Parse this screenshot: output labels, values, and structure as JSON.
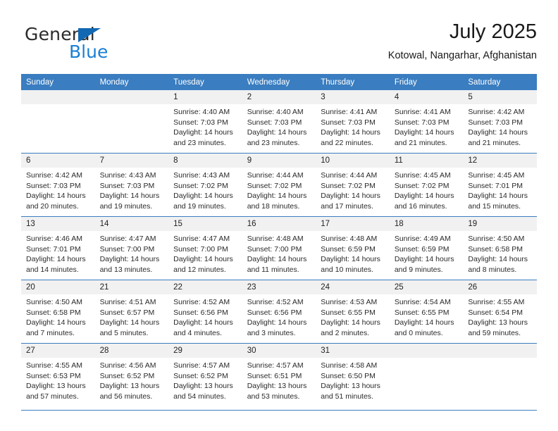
{
  "brand": {
    "word_one": "General",
    "word_two": "Blue",
    "triangle_icon": "brand-triangle-icon"
  },
  "header": {
    "title": "July 2025",
    "location": "Kotowal, Nangarhar, Afghanistan"
  },
  "calendar": {
    "weekday_headers": [
      "Sunday",
      "Monday",
      "Tuesday",
      "Wednesday",
      "Thursday",
      "Friday",
      "Saturday"
    ],
    "header_bg": "#3a7dc0",
    "daynum_bg": "#f1f1f1",
    "weeks": [
      [
        {
          "day": "",
          "lines": []
        },
        {
          "day": "",
          "lines": []
        },
        {
          "day": "1",
          "lines": [
            "Sunrise: 4:40 AM",
            "Sunset: 7:03 PM",
            "Daylight: 14 hours",
            "and 23 minutes."
          ]
        },
        {
          "day": "2",
          "lines": [
            "Sunrise: 4:40 AM",
            "Sunset: 7:03 PM",
            "Daylight: 14 hours",
            "and 23 minutes."
          ]
        },
        {
          "day": "3",
          "lines": [
            "Sunrise: 4:41 AM",
            "Sunset: 7:03 PM",
            "Daylight: 14 hours",
            "and 22 minutes."
          ]
        },
        {
          "day": "4",
          "lines": [
            "Sunrise: 4:41 AM",
            "Sunset: 7:03 PM",
            "Daylight: 14 hours",
            "and 21 minutes."
          ]
        },
        {
          "day": "5",
          "lines": [
            "Sunrise: 4:42 AM",
            "Sunset: 7:03 PM",
            "Daylight: 14 hours",
            "and 21 minutes."
          ]
        }
      ],
      [
        {
          "day": "6",
          "lines": [
            "Sunrise: 4:42 AM",
            "Sunset: 7:03 PM",
            "Daylight: 14 hours",
            "and 20 minutes."
          ]
        },
        {
          "day": "7",
          "lines": [
            "Sunrise: 4:43 AM",
            "Sunset: 7:03 PM",
            "Daylight: 14 hours",
            "and 19 minutes."
          ]
        },
        {
          "day": "8",
          "lines": [
            "Sunrise: 4:43 AM",
            "Sunset: 7:02 PM",
            "Daylight: 14 hours",
            "and 19 minutes."
          ]
        },
        {
          "day": "9",
          "lines": [
            "Sunrise: 4:44 AM",
            "Sunset: 7:02 PM",
            "Daylight: 14 hours",
            "and 18 minutes."
          ]
        },
        {
          "day": "10",
          "lines": [
            "Sunrise: 4:44 AM",
            "Sunset: 7:02 PM",
            "Daylight: 14 hours",
            "and 17 minutes."
          ]
        },
        {
          "day": "11",
          "lines": [
            "Sunrise: 4:45 AM",
            "Sunset: 7:02 PM",
            "Daylight: 14 hours",
            "and 16 minutes."
          ]
        },
        {
          "day": "12",
          "lines": [
            "Sunrise: 4:45 AM",
            "Sunset: 7:01 PM",
            "Daylight: 14 hours",
            "and 15 minutes."
          ]
        }
      ],
      [
        {
          "day": "13",
          "lines": [
            "Sunrise: 4:46 AM",
            "Sunset: 7:01 PM",
            "Daylight: 14 hours",
            "and 14 minutes."
          ]
        },
        {
          "day": "14",
          "lines": [
            "Sunrise: 4:47 AM",
            "Sunset: 7:00 PM",
            "Daylight: 14 hours",
            "and 13 minutes."
          ]
        },
        {
          "day": "15",
          "lines": [
            "Sunrise: 4:47 AM",
            "Sunset: 7:00 PM",
            "Daylight: 14 hours",
            "and 12 minutes."
          ]
        },
        {
          "day": "16",
          "lines": [
            "Sunrise: 4:48 AM",
            "Sunset: 7:00 PM",
            "Daylight: 14 hours",
            "and 11 minutes."
          ]
        },
        {
          "day": "17",
          "lines": [
            "Sunrise: 4:48 AM",
            "Sunset: 6:59 PM",
            "Daylight: 14 hours",
            "and 10 minutes."
          ]
        },
        {
          "day": "18",
          "lines": [
            "Sunrise: 4:49 AM",
            "Sunset: 6:59 PM",
            "Daylight: 14 hours",
            "and 9 minutes."
          ]
        },
        {
          "day": "19",
          "lines": [
            "Sunrise: 4:50 AM",
            "Sunset: 6:58 PM",
            "Daylight: 14 hours",
            "and 8 minutes."
          ]
        }
      ],
      [
        {
          "day": "20",
          "lines": [
            "Sunrise: 4:50 AM",
            "Sunset: 6:58 PM",
            "Daylight: 14 hours",
            "and 7 minutes."
          ]
        },
        {
          "day": "21",
          "lines": [
            "Sunrise: 4:51 AM",
            "Sunset: 6:57 PM",
            "Daylight: 14 hours",
            "and 5 minutes."
          ]
        },
        {
          "day": "22",
          "lines": [
            "Sunrise: 4:52 AM",
            "Sunset: 6:56 PM",
            "Daylight: 14 hours",
            "and 4 minutes."
          ]
        },
        {
          "day": "23",
          "lines": [
            "Sunrise: 4:52 AM",
            "Sunset: 6:56 PM",
            "Daylight: 14 hours",
            "and 3 minutes."
          ]
        },
        {
          "day": "24",
          "lines": [
            "Sunrise: 4:53 AM",
            "Sunset: 6:55 PM",
            "Daylight: 14 hours",
            "and 2 minutes."
          ]
        },
        {
          "day": "25",
          "lines": [
            "Sunrise: 4:54 AM",
            "Sunset: 6:55 PM",
            "Daylight: 14 hours",
            "and 0 minutes."
          ]
        },
        {
          "day": "26",
          "lines": [
            "Sunrise: 4:55 AM",
            "Sunset: 6:54 PM",
            "Daylight: 13 hours",
            "and 59 minutes."
          ]
        }
      ],
      [
        {
          "day": "27",
          "lines": [
            "Sunrise: 4:55 AM",
            "Sunset: 6:53 PM",
            "Daylight: 13 hours",
            "and 57 minutes."
          ]
        },
        {
          "day": "28",
          "lines": [
            "Sunrise: 4:56 AM",
            "Sunset: 6:52 PM",
            "Daylight: 13 hours",
            "and 56 minutes."
          ]
        },
        {
          "day": "29",
          "lines": [
            "Sunrise: 4:57 AM",
            "Sunset: 6:52 PM",
            "Daylight: 13 hours",
            "and 54 minutes."
          ]
        },
        {
          "day": "30",
          "lines": [
            "Sunrise: 4:57 AM",
            "Sunset: 6:51 PM",
            "Daylight: 13 hours",
            "and 53 minutes."
          ]
        },
        {
          "day": "31",
          "lines": [
            "Sunrise: 4:58 AM",
            "Sunset: 6:50 PM",
            "Daylight: 13 hours",
            "and 51 minutes."
          ]
        },
        {
          "day": "",
          "lines": []
        },
        {
          "day": "",
          "lines": []
        }
      ]
    ]
  }
}
